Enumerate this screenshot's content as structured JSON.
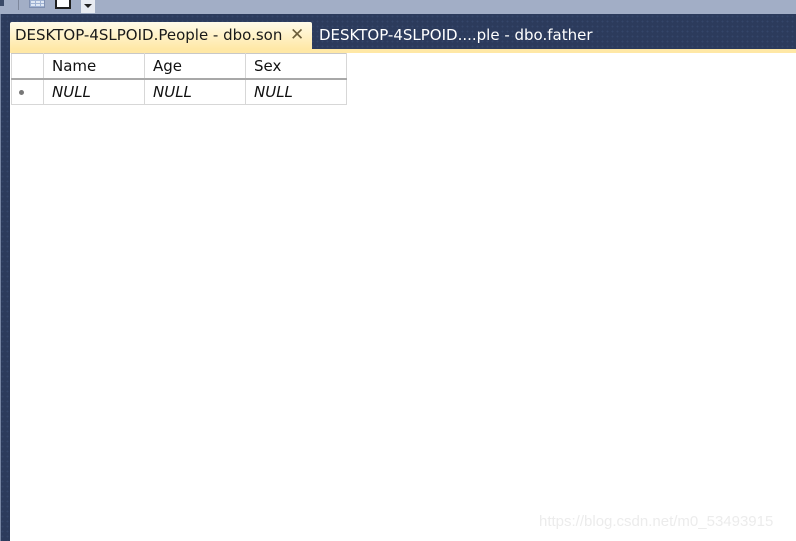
{
  "toolbar": {
    "icons": [
      "table-grid-icon",
      "text-results-icon",
      "dropdown-arrow-icon"
    ]
  },
  "tabs": [
    {
      "label": "DESKTOP-4SLPOID.People - dbo.son",
      "active": true,
      "close_glyph": "✕"
    },
    {
      "label": "DESKTOP-4SLPOID....ple - dbo.father",
      "active": false
    }
  ],
  "grid": {
    "columns": [
      "Name",
      "Age",
      "Sex"
    ],
    "rows": [
      {
        "marker": "new-row-icon",
        "cells": [
          "NULL",
          "NULL",
          "NULL"
        ]
      }
    ]
  },
  "colors": {
    "toolbar": "#a2aec6",
    "chrome_dark": "#2c3b5c",
    "active_tab": "#ffe8a6",
    "accent_line": "#ffe8a6"
  },
  "watermark": "https://blog.csdn.net/m0_53493915"
}
